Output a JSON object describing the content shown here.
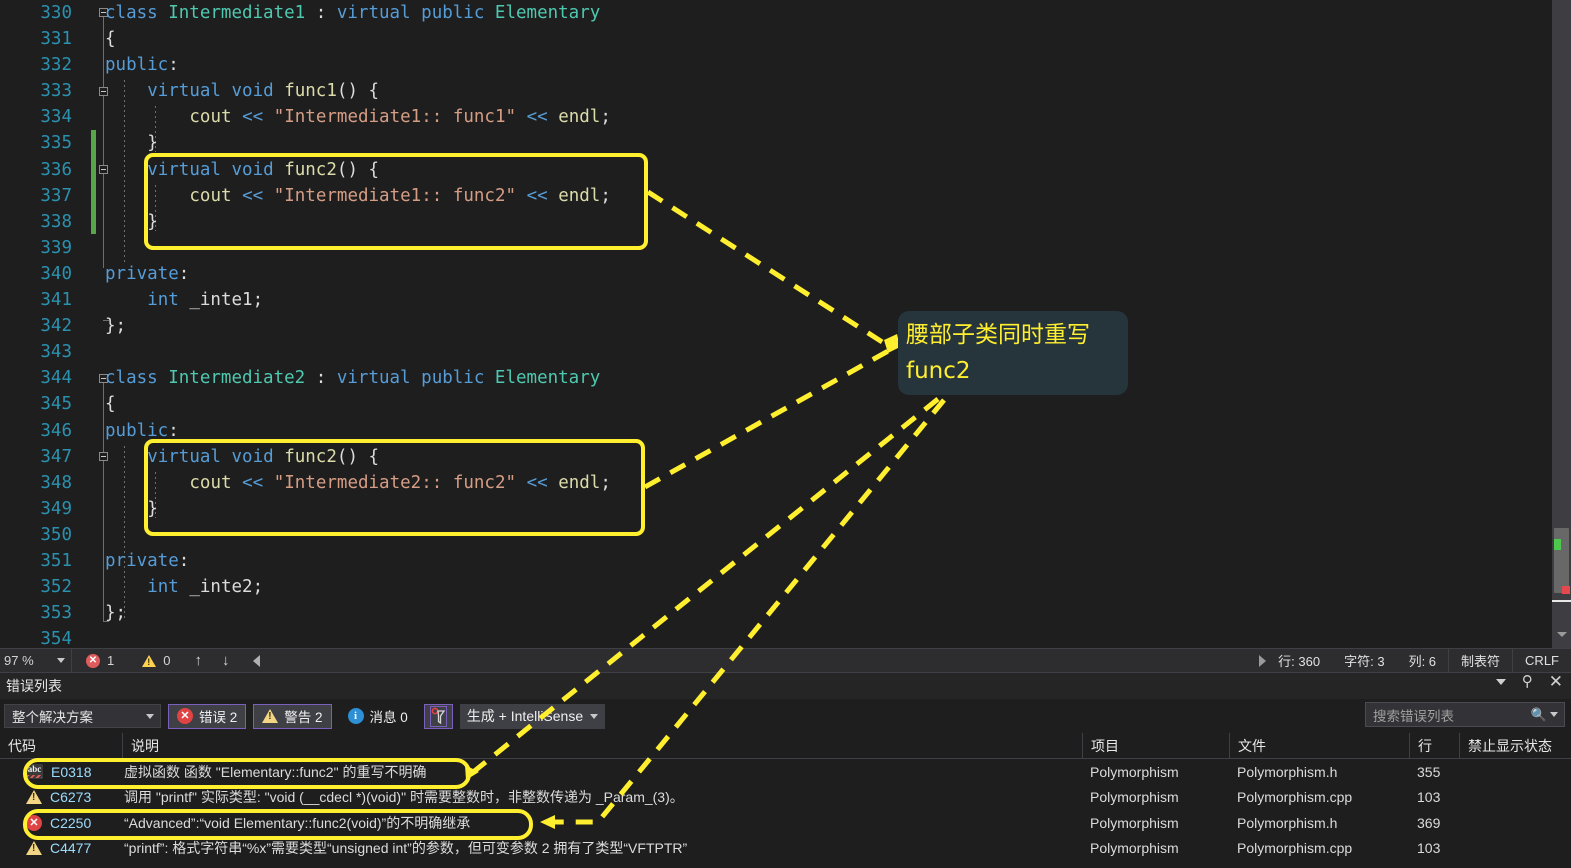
{
  "editor": {
    "first_line": 330,
    "lines": [
      {
        "n": 330,
        "text": "class Intermediate1 : virtual public Elementary"
      },
      {
        "n": 331,
        "text": "{"
      },
      {
        "n": 332,
        "text": "public:"
      },
      {
        "n": 333,
        "text": "    virtual void func1() {"
      },
      {
        "n": 334,
        "text": "        cout << \"Intermediate1:: func1\" << endl;"
      },
      {
        "n": 335,
        "text": "    }"
      },
      {
        "n": 336,
        "text": "    virtual void func2() {"
      },
      {
        "n": 337,
        "text": "        cout << \"Intermediate1:: func2\" << endl;"
      },
      {
        "n": 338,
        "text": "    }"
      },
      {
        "n": 339,
        "text": ""
      },
      {
        "n": 340,
        "text": "private:"
      },
      {
        "n": 341,
        "text": "    int _inte1;"
      },
      {
        "n": 342,
        "text": "};"
      },
      {
        "n": 343,
        "text": ""
      },
      {
        "n": 344,
        "text": "class Intermediate2 : virtual public Elementary"
      },
      {
        "n": 345,
        "text": "{"
      },
      {
        "n": 346,
        "text": "public:"
      },
      {
        "n": 347,
        "text": "    virtual void func2() {"
      },
      {
        "n": 348,
        "text": "        cout << \"Intermediate2:: func2\" << endl;"
      },
      {
        "n": 349,
        "text": "    }"
      },
      {
        "n": 350,
        "text": ""
      },
      {
        "n": 351,
        "text": "private:"
      },
      {
        "n": 352,
        "text": "    int _inte2;"
      },
      {
        "n": 353,
        "text": "};"
      },
      {
        "n": 354,
        "text": ""
      }
    ]
  },
  "annotation": {
    "callout_line1": "腰部子类同时重写",
    "callout_line2": "func2",
    "callout_bg": "#26343c",
    "highlight_color": "#ffef2e"
  },
  "statusbar": {
    "zoom": "97 %",
    "error_count": "1",
    "warning_count": "0",
    "up_arrow": "↑",
    "down_arrow": "↓",
    "line_label": "行: 360",
    "char_label": "字符: 3",
    "col_label": "列: 6",
    "tab_label": "制表符",
    "eol_label": "CRLF"
  },
  "error_panel": {
    "title": "错误列表",
    "scope_filter": "整个解决方案",
    "errors_toggle": "错误 2",
    "warnings_toggle": "警告 2",
    "messages_toggle": "消息 0",
    "build_filter": "生成 + IntelliSense",
    "search_placeholder": "搜索错误列表",
    "columns": [
      "代码",
      "说明",
      "项目",
      "文件",
      "行",
      "禁止显示状态"
    ],
    "rows": [
      {
        "icon": "intellisense-abc-icon",
        "code": "E0318",
        "description": "虚拟函数 函数 \"Elementary::func2\" 的重写不明确",
        "project": "Polymorphism",
        "file": "Polymorphism.h",
        "line": "355",
        "suppression": ""
      },
      {
        "icon": "warning-icon",
        "code": "C6273",
        "description": "调用 \"printf\" 实际类型: \"void (__cdecl *)(void)\" 时需要整数时，非整数传递为 _Param_(3)。",
        "project": "Polymorphism",
        "file": "Polymorphism.cpp",
        "line": "103",
        "suppression": ""
      },
      {
        "icon": "error-icon",
        "code": "C2250",
        "description": "“Advanced”:“void Elementary::func2(void)”的不明确继承",
        "project": "Polymorphism",
        "file": "Polymorphism.h",
        "line": "369",
        "suppression": ""
      },
      {
        "icon": "warning-icon",
        "code": "C4477",
        "description": "“printf”: 格式字符串“%x”需要类型“unsigned int”的参数，但可变参数 2 拥有了类型“VFTPTR”",
        "project": "Polymorphism",
        "file": "Polymorphism.cpp",
        "line": "103",
        "suppression": ""
      }
    ]
  }
}
